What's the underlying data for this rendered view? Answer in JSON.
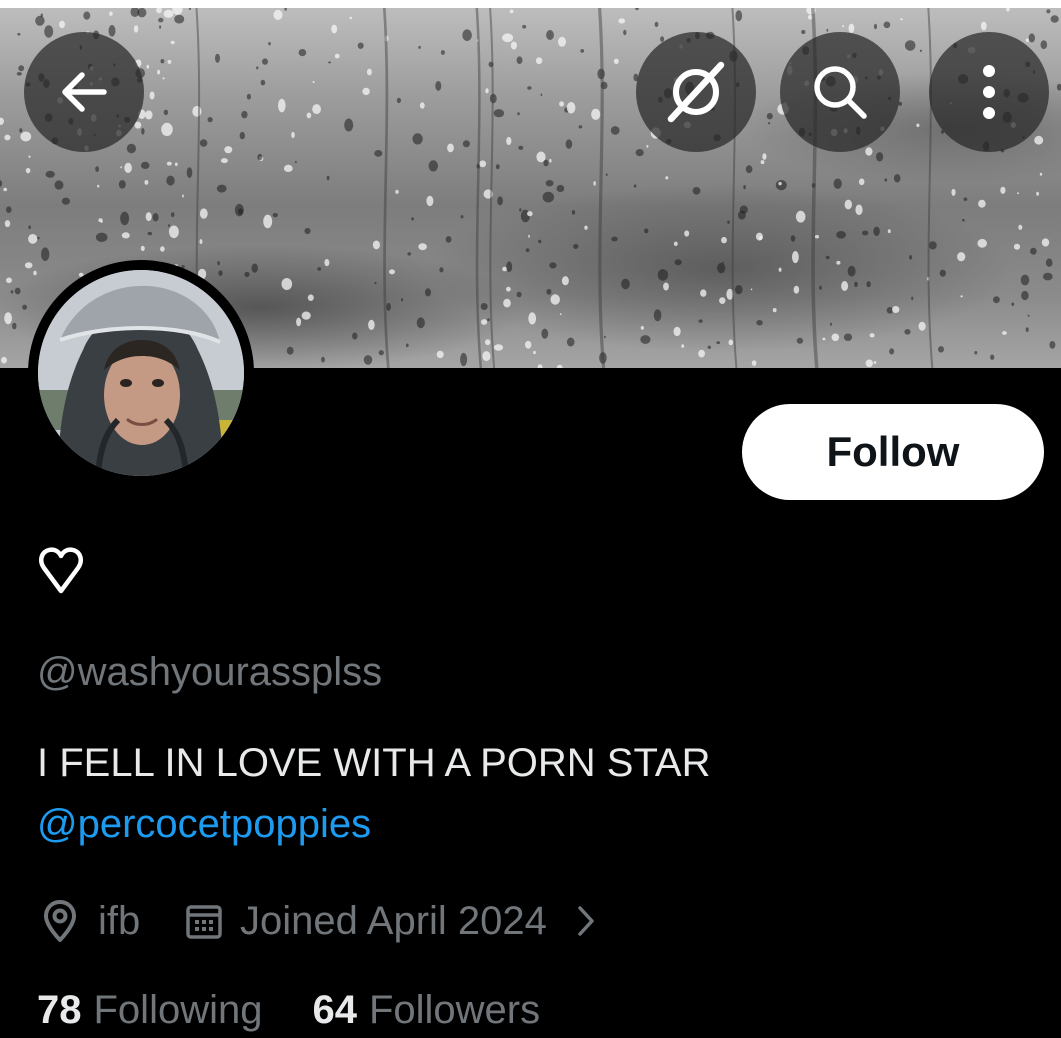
{
  "header": {
    "back_icon": "arrow-left-icon",
    "grok_icon": "grok-icon",
    "search_icon": "search-icon",
    "more_icon": "more-vertical-icon"
  },
  "profile": {
    "display_name_icon": "heart-outline-icon",
    "handle": "@washyourassplss",
    "bio_line": "I FELL IN LOVE WITH A PORN STAR",
    "bio_mention": "@percocetpoppies",
    "location": "ifb",
    "joined": "Joined April 2024",
    "following_count": "78",
    "following_label": "Following",
    "followers_count": "64",
    "followers_label": "Followers"
  },
  "actions": {
    "follow_label": "Follow"
  },
  "colors": {
    "background": "#000000",
    "text_primary": "#e7e9ea",
    "text_secondary": "#71767b",
    "link": "#1d9bf0",
    "follow_bg": "#ffffff",
    "follow_text": "#0f1419"
  }
}
